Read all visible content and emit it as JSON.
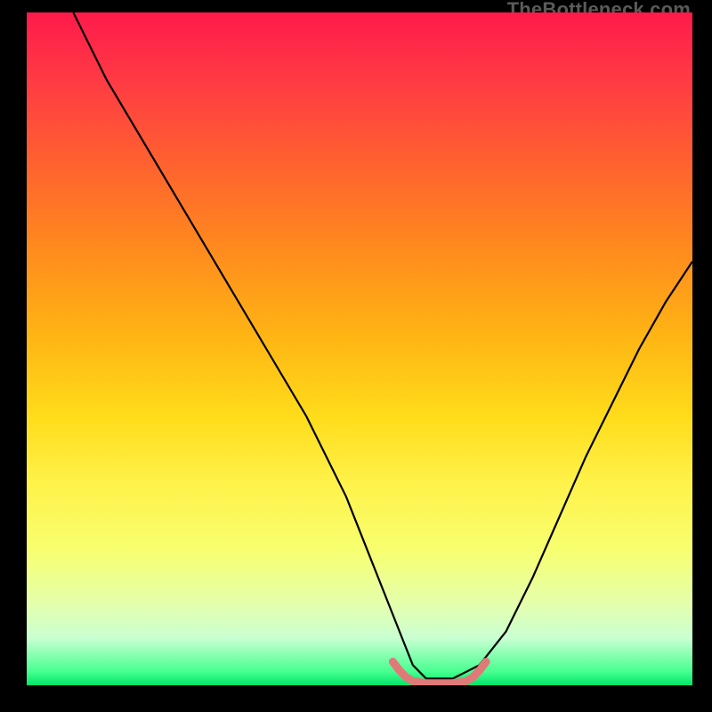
{
  "watermark": {
    "text": "TheBottleneck.com"
  },
  "chart_data": {
    "type": "line",
    "title": "",
    "xlabel": "",
    "ylabel": "",
    "xlim": [
      0,
      100
    ],
    "ylim": [
      0,
      100
    ],
    "grid": false,
    "series": [
      {
        "name": "black-curve",
        "color": "#000000",
        "x": [
          7,
          12,
          18,
          24,
          30,
          36,
          42,
          48,
          52,
          56,
          58,
          60,
          64,
          68,
          72,
          76,
          80,
          84,
          88,
          92,
          96,
          100
        ],
        "y": [
          100,
          90,
          80,
          70,
          60,
          50,
          40,
          28,
          18,
          8,
          3,
          1,
          1,
          3,
          8,
          16,
          25,
          34,
          42,
          50,
          57,
          63
        ]
      },
      {
        "name": "pink-band",
        "color": "#e07a7a",
        "x": [
          55,
          56,
          57,
          58,
          60,
          62,
          64,
          66,
          67,
          68,
          69
        ],
        "y": [
          3.5,
          2.2,
          1.2,
          0.6,
          0.3,
          0.3,
          0.3,
          0.6,
          1.2,
          2.2,
          3.5
        ]
      }
    ],
    "annotations": []
  }
}
